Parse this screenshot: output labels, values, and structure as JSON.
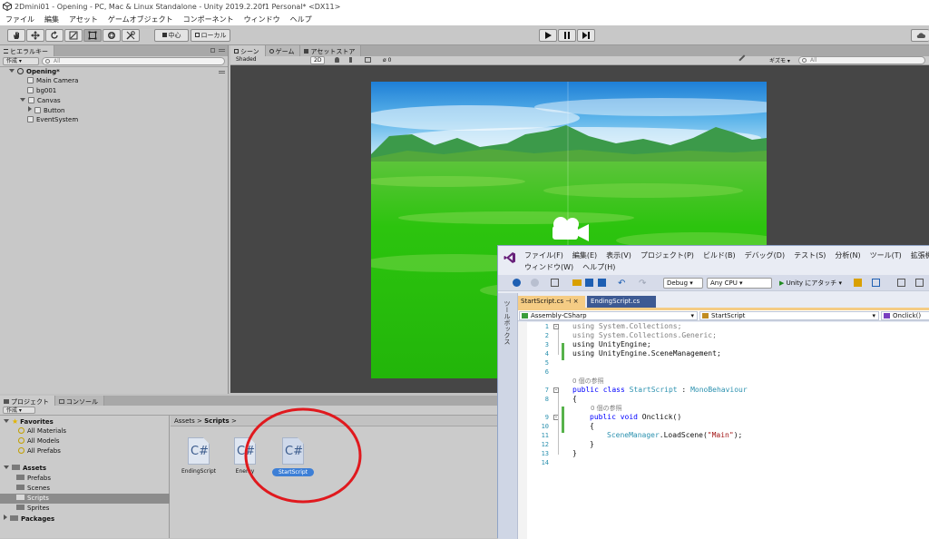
{
  "window": {
    "title": "2Dmini01 - Opening - PC, Mac & Linux Standalone - Unity 2019.2.20f1 Personal* <DX11>"
  },
  "menu": [
    "ファイル",
    "編集",
    "アセット",
    "ゲームオブジェクト",
    "コンポーネント",
    "ウィンドウ",
    "ヘルプ"
  ],
  "toolbar": {
    "pivot_label": "中心",
    "local_label": "ローカル"
  },
  "hierarchy": {
    "tab": "ヒエラルキー",
    "create_label": "作成",
    "search_placeholder": "All",
    "scene": "Opening*",
    "items": [
      "Main Camera",
      "bg001",
      "Canvas",
      "Button",
      "EventSystem"
    ]
  },
  "scene_view": {
    "tabs": [
      "シーン",
      "ゲーム",
      "アセットストア"
    ],
    "shading": "Shaded",
    "mode_2d": "2D",
    "fx_count": "0",
    "gizmos": "ギズモ",
    "search_placeholder": "All"
  },
  "project": {
    "tabs": [
      "プロジェクト",
      "コンソール"
    ],
    "create_label": "作成",
    "favorites_label": "Favorites",
    "favorites": [
      "All Materials",
      "All Models",
      "All Prefabs"
    ],
    "assets_label": "Assets",
    "folders": [
      "Prefabs",
      "Scenes",
      "Scripts",
      "Sprites"
    ],
    "packages_label": "Packages",
    "breadcrumb": [
      "Assets",
      "Scripts"
    ],
    "files": [
      "EndingScript",
      "Enemy",
      "StartScript"
    ],
    "file_glyph": "C#"
  },
  "vs": {
    "menu_row1": [
      "ファイル(F)",
      "編集(E)",
      "表示(V)",
      "プロジェクト(P)",
      "ビルド(B)",
      "デバッグ(D)",
      "テスト(S)",
      "分析(N)",
      "ツール(T)",
      "拡張機能(X)"
    ],
    "menu_row2": [
      "ウィンドウ(W)",
      "ヘルプ(H)"
    ],
    "config": "Debug",
    "platform": "Any CPU",
    "attach": "Unity にアタッチ",
    "toolbox_label": "ツールボックス",
    "tabs": [
      "StartScript.cs",
      "EndingScript.cs"
    ],
    "nav_project": "Assembly-CSharp",
    "nav_class": "StartScript",
    "nav_member": "Onclick()",
    "ref_count_class": "0 個の参照",
    "ref_count_method": "0 個の参照",
    "line_numbers": [
      "1",
      "2",
      "3",
      "4",
      "5",
      "6",
      "7",
      "8",
      "9",
      "10",
      "11",
      "12",
      "13",
      "14"
    ],
    "code": {
      "l1": "using System.Collections;",
      "l2": "using System.Collections.Generic;",
      "l3": "using UnityEngine;",
      "l4": "using UnityEngine.SceneManagement;",
      "l7_kw": "public class ",
      "l7_name": "StartScript",
      "l7_sep": " : ",
      "l7_base": "MonoBehaviour",
      "l8": "{",
      "l9_kw": "public void ",
      "l9_name": "Onclick()",
      "l10": "{",
      "l11_type": "SceneManager",
      "l11_call": ".LoadScene(",
      "l11_str": "\"Main\"",
      "l11_end": ");",
      "l12": "}",
      "l13": "}"
    }
  },
  "colors": {
    "vs_accent": "#68217a",
    "selection": "#3d7fd6"
  }
}
